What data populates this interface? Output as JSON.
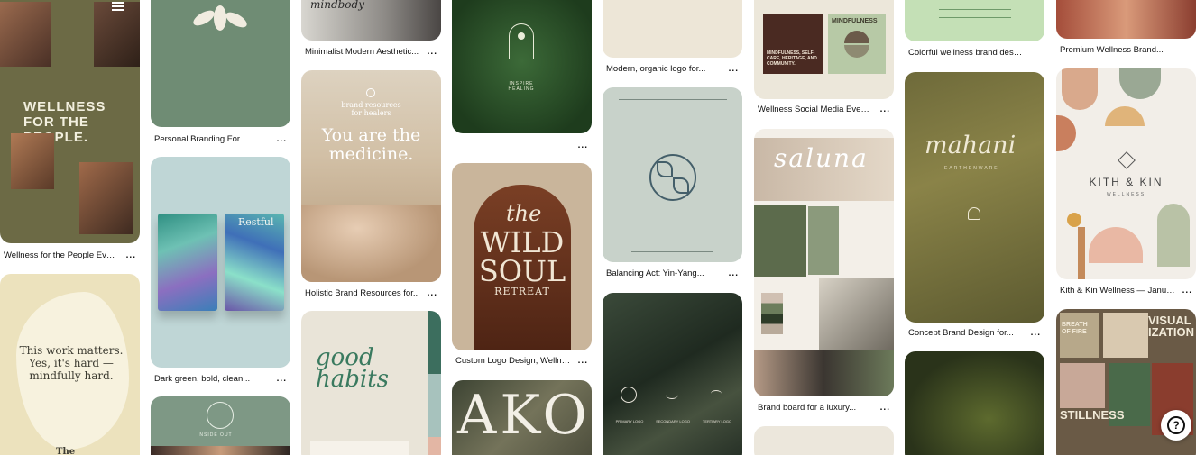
{
  "pins": {
    "wellness_people": {
      "title": "Wellness for the People Event...",
      "art": "WELLNESS FOR THE PEOPLE."
    },
    "personal_branding": {
      "title": "Personal Branding For..."
    },
    "minimalist_modern": {
      "title": "Minimalist Modern Aesthetic...",
      "art": "mindbody"
    },
    "holistic_brand": {
      "title": "Holistic Brand Resources for...",
      "art_small": "brand resources for healers",
      "art": "You are the medicine."
    },
    "dark_green": {
      "title": "Dark green, bold, clean...",
      "art": "Restful"
    },
    "work_matters": {
      "art": "This work matters. Yes, it's hard — mindfully hard.",
      "art_footer": "The"
    },
    "inside_out": {
      "art": "INSIDE OUT"
    },
    "good_habits": {
      "art": "good habits"
    },
    "forest_logo": {
      "art": "INSPIRE HEALING"
    },
    "wild_soul": {
      "title": "Custom Logo Design, Wellne...",
      "art_the": "the",
      "art_wild": "WILD",
      "art_soul": "SOUL",
      "art_retreat": "RETREAT"
    },
    "ako": {
      "art": "AKO"
    },
    "modern_organic": {
      "title": "Modern, organic logo for..."
    },
    "balancing_act": {
      "title": "Balancing Act: Yin-Yang..."
    },
    "dark_marble": {
      "labels": [
        "PRIMARY LOGO",
        "SECONDARY LOGO",
        "TERTIARY LOGO"
      ]
    },
    "wellness_social": {
      "title": "Wellness Social Media Event...",
      "art_a": "MINDFULNESS, SELF-CARE, HERITAGE, AND COMMUNITY.",
      "art_b": "MINDFULNESS"
    },
    "brand_board": {
      "title": "Brand board for a luxury...",
      "art": "saluna"
    },
    "colorful_wellness": {
      "title": "Colorful wellness brand design"
    },
    "concept_brand": {
      "title": "Concept Brand Design for...",
      "art": "mahani",
      "art_sub": "EARTHENWARE"
    },
    "premium_wellness": {
      "title": "Premium Wellness Brand..."
    },
    "kith_kin": {
      "title": "Kith & Kin Wellness — Januar...",
      "art": "KITH & KIN",
      "art_sub": "WELLNESS"
    },
    "breath_grid": {
      "art_a": "BREATH OF FIRE",
      "art_b": "VISUAL IZATION",
      "art_c": "STILLNESS"
    }
  },
  "ui": {
    "more": "...",
    "help": "?"
  },
  "colors": {
    "olive": "#6c6a45",
    "sage": "#6f8c74",
    "cream": "#efe9db",
    "dark_green": "#2d3b28"
  }
}
